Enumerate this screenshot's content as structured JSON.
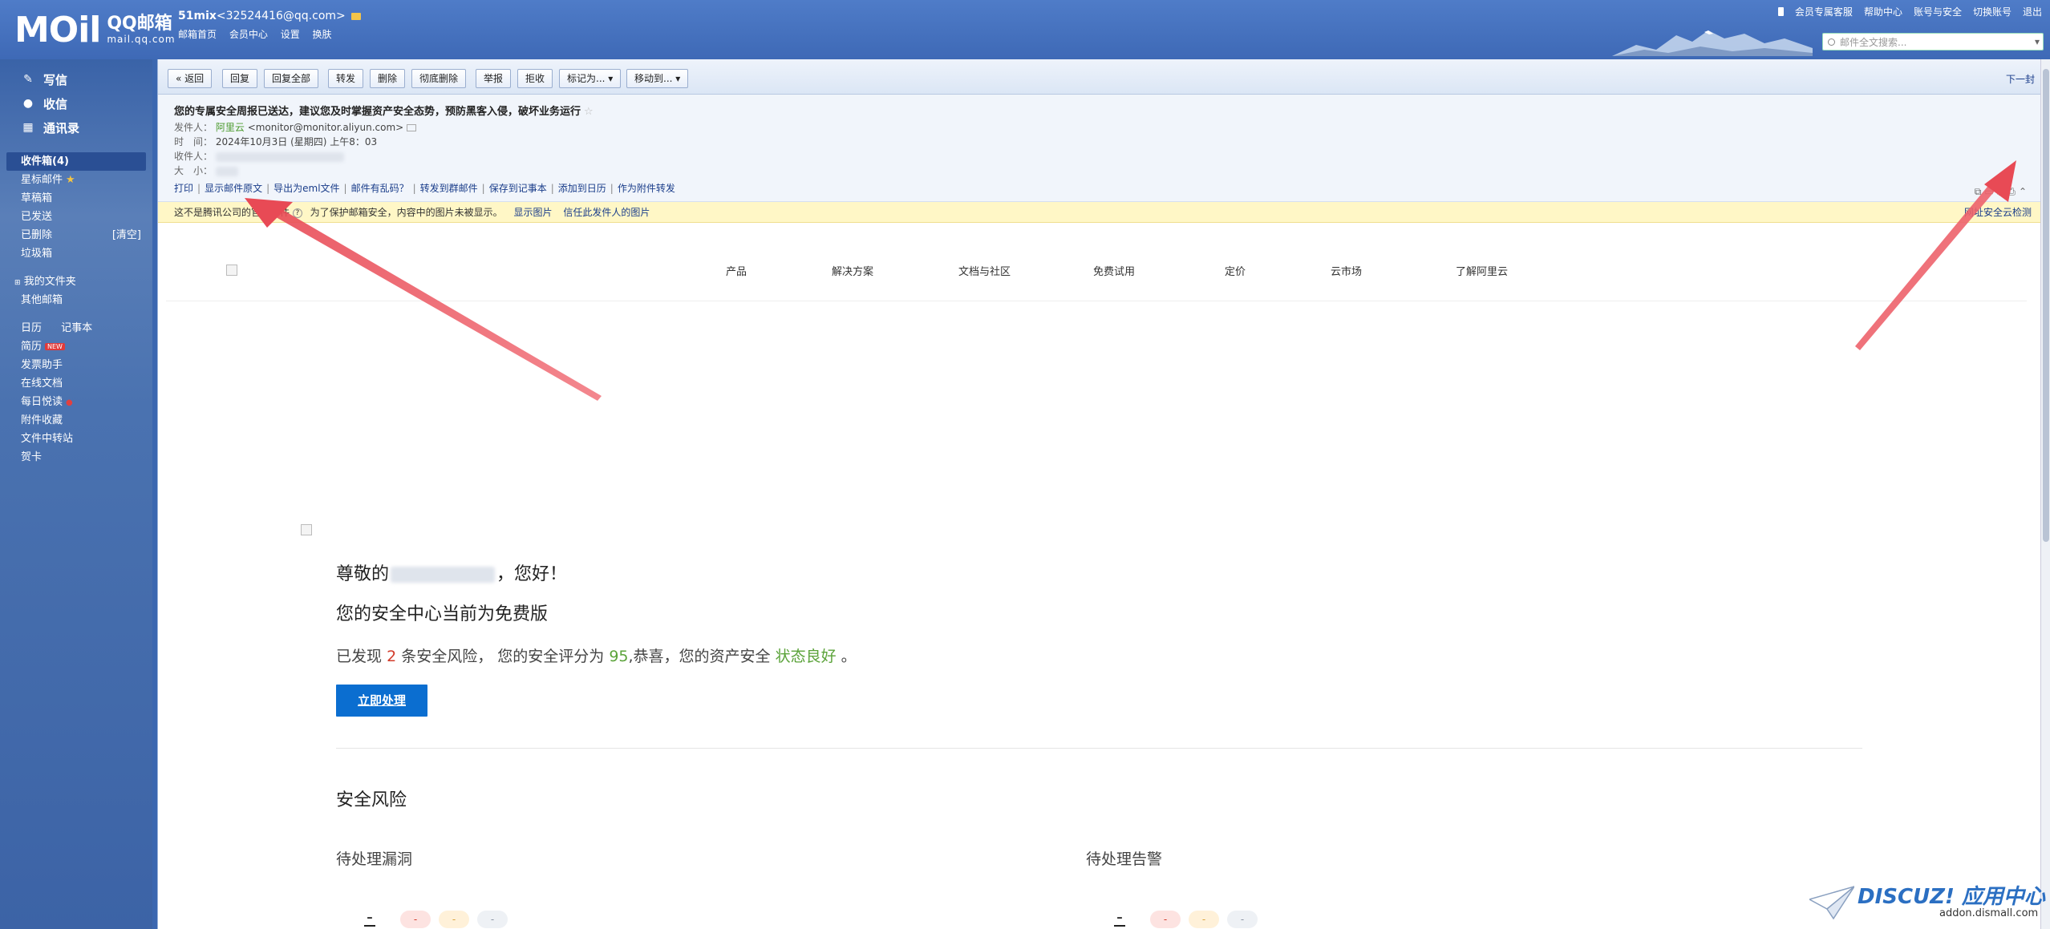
{
  "header": {
    "logo_mark": "MOil",
    "logo_cn": "QQ邮箱",
    "logo_domain": "mail.qq.com",
    "account_name": "51mix",
    "account_email": "<32524416@qq.com>",
    "account_links": [
      "邮箱首页",
      "会员中心",
      "设置",
      "换肤"
    ],
    "top_links": [
      "会员专属客服",
      "帮助中心",
      "账号与安全",
      "切换账号",
      "退出"
    ],
    "search_placeholder": "邮件全文搜索..."
  },
  "sidebar": {
    "compose": "写信",
    "inbox_btn": "收信",
    "contacts": "通讯录",
    "folders": [
      {
        "label": "收件箱(4)"
      },
      {
        "label": "星标邮件"
      },
      {
        "label": "草稿箱"
      },
      {
        "label": "已发送"
      },
      {
        "label": "已删除",
        "extra": "[清空]"
      },
      {
        "label": "垃圾箱"
      }
    ],
    "my_folders": "我的文件夹",
    "other_mail": "其他邮箱",
    "tools": [
      {
        "label": "日历"
      },
      {
        "label": "记事本"
      },
      {
        "label": "简历",
        "badge": "NEW"
      },
      {
        "label": "发票助手"
      },
      {
        "label": "在线文档"
      },
      {
        "label": "每日悦读"
      },
      {
        "label": "附件收藏"
      },
      {
        "label": "文件中转站"
      },
      {
        "label": "贺卡"
      }
    ]
  },
  "toolbar": {
    "back": "« 返回",
    "reply": "回复",
    "reply_all": "回复全部",
    "forward": "转发",
    "delete": "删除",
    "perm_delete": "彻底删除",
    "report": "举报",
    "reject": "拒收",
    "mark_as": "标记为... ▾",
    "move_to": "移动到... ▾",
    "next": "下一封"
  },
  "mail_header": {
    "subject": "您的专属安全周报已送达，建议您及时掌握资产安全态势，预防黑客入侵，破坏业务运行",
    "sender_label": "发件人：",
    "sender_name": "阿里云",
    "sender_email": "<monitor@monitor.aliyun.com>",
    "time_label": "时　间：",
    "time_value": "2024年10月3日 (星期四) 上午8：03",
    "recipient_label": "收件人：",
    "size_label": "大　小：",
    "actions": [
      "打印",
      "显示邮件原文",
      "导出为eml文件",
      "邮件有乱码？",
      "转发到群邮件",
      "保存到记事本",
      "添加到日历",
      "作为附件转发"
    ]
  },
  "security_bar": {
    "text_a": "这不是腾讯公司的官方邮件",
    "text_b": "为了保护邮箱安全，内容中的图片未被显示。",
    "show_images": "显示图片",
    "trust_sender": "信任此发件人的图片",
    "right_text": "网址安全云检测"
  },
  "email_body": {
    "nav": [
      "产品",
      "解决方案",
      "文档与社区",
      "免费试用",
      "定价",
      "云市场",
      "了解阿里云"
    ],
    "greeting_prefix": "尊敬的",
    "greeting_suffix": "，您好！",
    "plan": "您的安全中心当前为免费版",
    "found_a": "已发现",
    "risk_count": "2",
    "found_b": "条安全风险，",
    "found_c": "您的安全评分为",
    "score": "95",
    "found_d": ",恭喜，您的资产安全",
    "status": "状态良好",
    "found_e": "。",
    "cta": "立即处理",
    "risk_title": "安全风险",
    "vuln_title": "待处理漏洞",
    "alert_title": "待处理告警",
    "dash": "-"
  },
  "watermark": {
    "brand": "DISCUZ! 应用中心",
    "url": "addon.dismall.com"
  },
  "colors": {
    "header_blue": "#4f7cc8",
    "cta_blue": "#0b6ed0",
    "risk_red": "#d23b2a",
    "ok_green": "#5ba33a",
    "arrow_red": "#e84a55",
    "warning_yellow": "#fff7c6"
  }
}
